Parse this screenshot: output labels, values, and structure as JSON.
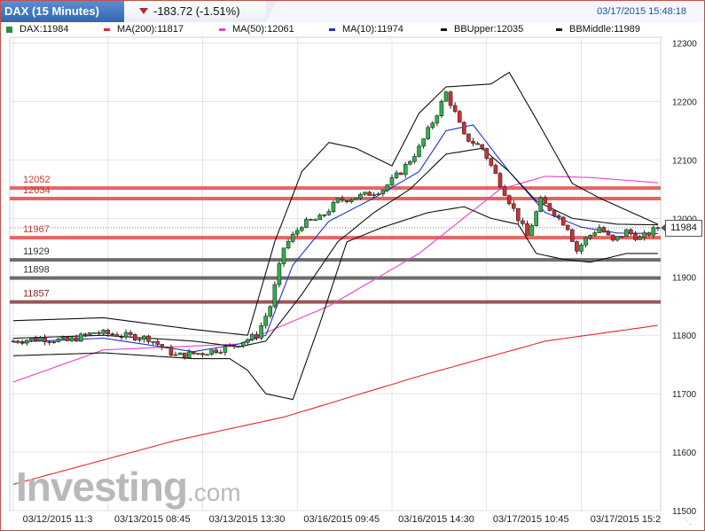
{
  "header": {
    "title": "DAX (15 Minutes)",
    "change": "-183.72 (-1.51%)",
    "timestamp": "03/17/2015 15:48:18",
    "down_color": "#c0252b"
  },
  "legend": [
    {
      "label": "DAX:11984",
      "color": "#2e8b3c",
      "icon": "square-icon"
    },
    {
      "label": "MA(200):11817",
      "color": "#e5262e"
    },
    {
      "label": "MA(50):12061",
      "color": "#ea3fc8"
    },
    {
      "label": "MA(10):11974",
      "color": "#1f35c8"
    },
    {
      "label": "BBUpper:12035",
      "color": "#111111"
    },
    {
      "label": "BBMiddle:11989",
      "color": "#111111"
    }
  ],
  "watermark": {
    "brand": "Investing",
    "suffix": ".com"
  },
  "last_price_label": "11984",
  "chart_data": {
    "type": "candlestick",
    "title": "DAX (15 Minutes)",
    "ylim": [
      11500,
      12310
    ],
    "y_ticks": [
      11500,
      11600,
      11700,
      11800,
      11900,
      12000,
      12100,
      12200,
      12300
    ],
    "x_tick_labels": [
      "03/12/2015 11:3",
      "03/13/2015 08:45",
      "03/13/2015 13:30",
      "03/16/2015 09:45",
      "03/16/2015 14:30",
      "03/17/2015 10:45",
      "03/17/2015 15:2"
    ],
    "n_bars": 144,
    "x_tick_index": [
      0,
      21,
      42,
      63,
      84,
      105,
      126
    ],
    "candle_up_color": "#2db34a",
    "candle_down_color": "#d42f2f",
    "levels": [
      {
        "value": 12052,
        "label": "12052",
        "color": "#e04a4a",
        "label_color": "#c0392b"
      },
      {
        "value": 12034,
        "label": "12034",
        "color": "#e04a4a",
        "label_color": "#c0392b"
      },
      {
        "value": 11967,
        "label": "11967",
        "color": "#e04a4a",
        "label_color": "#c0392b"
      },
      {
        "value": 11929,
        "label": "11929",
        "color": "#555555",
        "label_color": "#333333"
      },
      {
        "value": 11898,
        "label": "11898",
        "color": "#555555",
        "label_color": "#333333"
      },
      {
        "value": 11857,
        "label": "11857",
        "color": "#8b3a3a",
        "label_color": "#8b2222"
      }
    ],
    "last_price": 11984,
    "anchors": [
      [
        0,
        11790
      ],
      [
        6,
        11795
      ],
      [
        12,
        11790
      ],
      [
        18,
        11805
      ],
      [
        24,
        11800
      ],
      [
        30,
        11795
      ],
      [
        36,
        11765
      ],
      [
        42,
        11770
      ],
      [
        48,
        11780
      ],
      [
        54,
        11800
      ],
      [
        57,
        11850
      ],
      [
        60,
        11950
      ],
      [
        64,
        11990
      ],
      [
        68,
        12000
      ],
      [
        72,
        12030
      ],
      [
        78,
        12040
      ],
      [
        82,
        12050
      ],
      [
        86,
        12080
      ],
      [
        90,
        12120
      ],
      [
        94,
        12180
      ],
      [
        96,
        12215
      ],
      [
        98,
        12180
      ],
      [
        100,
        12140
      ],
      [
        104,
        12120
      ],
      [
        108,
        12060
      ],
      [
        112,
        12000
      ],
      [
        114,
        11970
      ],
      [
        117,
        12030
      ],
      [
        120,
        12010
      ],
      [
        123,
        11985
      ],
      [
        125,
        11945
      ],
      [
        127,
        11965
      ],
      [
        130,
        11985
      ],
      [
        133,
        11960
      ],
      [
        136,
        11978
      ],
      [
        139,
        11965
      ],
      [
        143,
        11984
      ]
    ],
    "series": [
      {
        "name": "MA(200)",
        "color": "#e5262e",
        "anchors": [
          [
            0,
            11545
          ],
          [
            36,
            11620
          ],
          [
            60,
            11660
          ],
          [
            90,
            11730
          ],
          [
            118,
            11790
          ],
          [
            143,
            11817
          ]
        ]
      },
      {
        "name": "MA(50)",
        "color": "#ea3fc8",
        "anchors": [
          [
            0,
            11720
          ],
          [
            20,
            11775
          ],
          [
            50,
            11785
          ],
          [
            70,
            11850
          ],
          [
            90,
            11940
          ],
          [
            108,
            12050
          ],
          [
            118,
            12072
          ],
          [
            128,
            12070
          ],
          [
            143,
            12061
          ]
        ]
      },
      {
        "name": "MA(10)",
        "color": "#1f35c8",
        "anchors": [
          [
            0,
            11788
          ],
          [
            20,
            11795
          ],
          [
            40,
            11772
          ],
          [
            50,
            11785
          ],
          [
            56,
            11800
          ],
          [
            62,
            11920
          ],
          [
            70,
            11995
          ],
          [
            80,
            12035
          ],
          [
            90,
            12080
          ],
          [
            96,
            12150
          ],
          [
            102,
            12160
          ],
          [
            110,
            12080
          ],
          [
            118,
            12010
          ],
          [
            126,
            11985
          ],
          [
            134,
            11975
          ],
          [
            143,
            11974
          ]
        ]
      },
      {
        "name": "BBUpper",
        "color": "#111111",
        "anchors": [
          [
            0,
            11825
          ],
          [
            20,
            11830
          ],
          [
            40,
            11810
          ],
          [
            52,
            11800
          ],
          [
            58,
            11960
          ],
          [
            64,
            12080
          ],
          [
            70,
            12130
          ],
          [
            76,
            12120
          ],
          [
            84,
            12090
          ],
          [
            90,
            12180
          ],
          [
            96,
            12225
          ],
          [
            106,
            12230
          ],
          [
            110,
            12250
          ],
          [
            116,
            12170
          ],
          [
            124,
            12060
          ],
          [
            130,
            12035
          ],
          [
            143,
            11990
          ]
        ]
      },
      {
        "name": "BBMiddle",
        "color": "#111111",
        "anchors": [
          [
            0,
            11795
          ],
          [
            20,
            11800
          ],
          [
            40,
            11790
          ],
          [
            50,
            11780
          ],
          [
            56,
            11790
          ],
          [
            64,
            11870
          ],
          [
            72,
            11960
          ],
          [
            80,
            12010
          ],
          [
            88,
            12050
          ],
          [
            96,
            12110
          ],
          [
            104,
            12120
          ],
          [
            110,
            12080
          ],
          [
            116,
            12030
          ],
          [
            124,
            12000
          ],
          [
            134,
            11990
          ],
          [
            143,
            11989
          ]
        ]
      },
      {
        "name": "BBLower",
        "color": "#111111",
        "anchors": [
          [
            0,
            11765
          ],
          [
            20,
            11770
          ],
          [
            40,
            11760
          ],
          [
            48,
            11760
          ],
          [
            52,
            11740
          ],
          [
            56,
            11700
          ],
          [
            62,
            11690
          ],
          [
            68,
            11820
          ],
          [
            74,
            11960
          ],
          [
            82,
            11985
          ],
          [
            92,
            12010
          ],
          [
            100,
            12020
          ],
          [
            106,
            12000
          ],
          [
            112,
            11990
          ],
          [
            116,
            11940
          ],
          [
            122,
            11930
          ],
          [
            128,
            11925
          ],
          [
            136,
            11940
          ],
          [
            143,
            11940
          ]
        ]
      }
    ]
  }
}
